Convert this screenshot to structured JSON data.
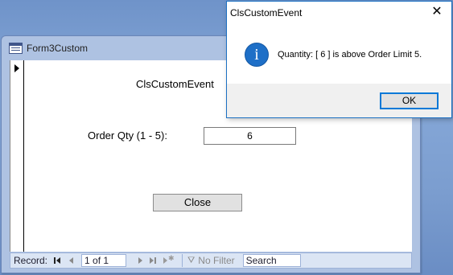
{
  "form_window": {
    "title": "Form3Custom",
    "heading": "ClsCustomEvent",
    "qty_label": "Order Qty (1 - 5):",
    "qty_value": "6",
    "close_label": "Close",
    "nav": {
      "record_label": "Record:",
      "record_position": "1 of 1",
      "filter_label": "No Filter",
      "search_label": "Search"
    }
  },
  "dialog": {
    "title": "ClsCustomEvent",
    "close_glyph": "✕",
    "icon_glyph": "i",
    "message": "Quantity: [ 6 ] is above Order Limit 5.",
    "ok_label": "OK"
  },
  "colors": {
    "accent": "#0078d7",
    "info_icon": "#1e6fc7",
    "desktop": "#7b9dcf"
  }
}
